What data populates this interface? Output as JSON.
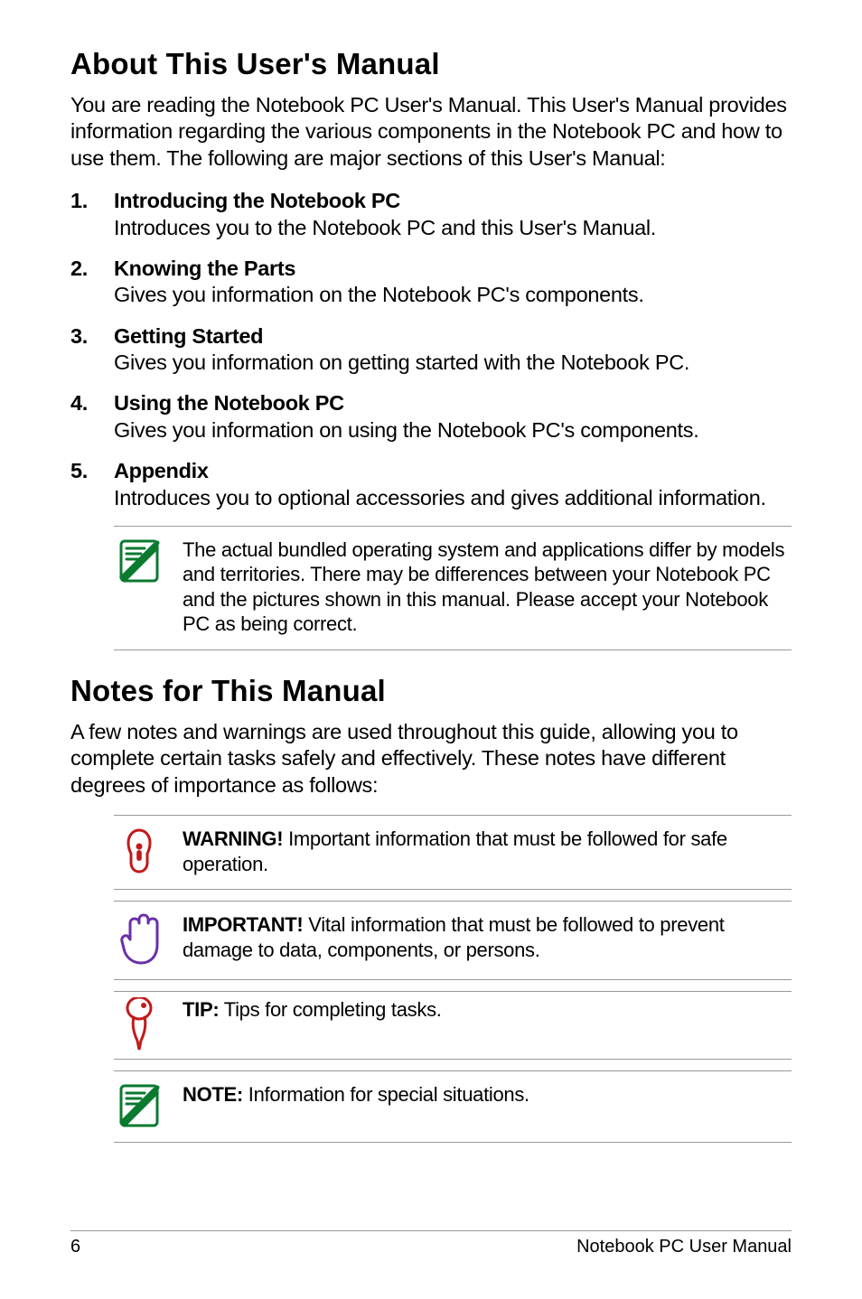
{
  "heading1": "About This User's Manual",
  "intro1": "You are reading the Notebook PC User's Manual. This User's Manual provides information regarding the various components in the Notebook PC and how to use them. The following are major sections of this User's Manual:",
  "sections": [
    {
      "title": "Introducing the Notebook PC",
      "body": "Introduces you to the Notebook PC and this User's Manual."
    },
    {
      "title": "Knowing the Parts",
      "body": "Gives you information on the Notebook PC's components."
    },
    {
      "title": "Getting Started",
      "body": "Gives you information on getting started with the Notebook PC."
    },
    {
      "title": "Using the Notebook PC",
      "body": "Gives you information on using the Notebook PC's components."
    },
    {
      "title": "Appendix",
      "body": "Introduces you to optional accessories and gives additional information."
    }
  ],
  "note1": "The actual bundled operating system and applications differ by models and territories. There may be differences between your Notebook PC and the pictures shown in this manual. Please accept your Notebook PC as being correct.",
  "heading2": "Notes for This Manual",
  "intro2": "A few notes and warnings are used throughout this guide, allowing you to complete certain tasks safely and effectively. These notes have different degrees of importance as follows:",
  "warning": {
    "label": "WARNING!",
    "body": " Important information that must be followed for safe operation."
  },
  "important": {
    "label": "IMPORTANT!",
    "body": " Vital information that must be followed to prevent damage to data, components, or persons."
  },
  "tip": {
    "label": "TIP:",
    "body": " Tips for completing tasks."
  },
  "note": {
    "label": "NOTE:",
    "body": "  Information for special situations."
  },
  "footer": {
    "page": "6",
    "label": "Notebook PC User Manual"
  },
  "icons": {
    "note_doc": "note-document-icon",
    "warning_hand": "warning-hand-icon",
    "important_hand": "important-hand-icon",
    "tip_pin": "tip-pin-icon"
  }
}
